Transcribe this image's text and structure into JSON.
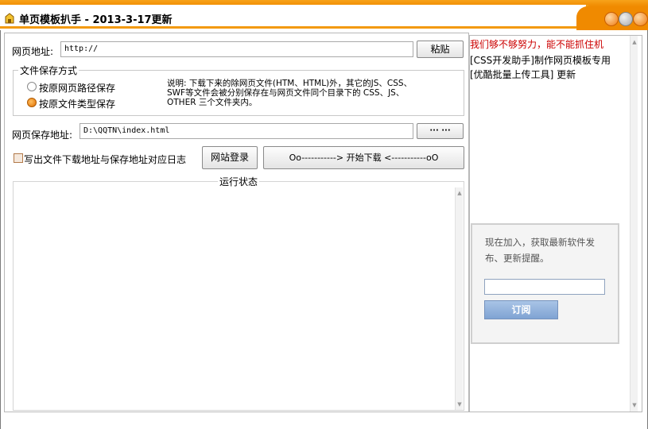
{
  "window": {
    "title": "单页模板扒手 - 2013-3-17更新"
  },
  "url_row": {
    "label": "网页地址:",
    "value": "http://",
    "paste_button": "粘贴"
  },
  "save_mode": {
    "legend": "文件保存方式",
    "options": [
      {
        "label": "按原网页路径保存",
        "checked": false
      },
      {
        "label": "按原文件类型保存",
        "checked": true
      }
    ],
    "note_lines": [
      "说明: 下载下来的除网页文件(HTM、HTML)外，其它的JS、CSS、",
      "SWF等文件会被分别保存在与网页文件同个目录下的 CSS、JS、",
      "OTHER 三个文件夹内。"
    ]
  },
  "save_path": {
    "label": "网页保存地址:",
    "value": "D:\\QQTN\\index.html",
    "browse_button": "··· ···"
  },
  "log_checkbox": {
    "label": "写出文件下载地址与保存地址对应日志",
    "checked": false
  },
  "login_button": "网站登录",
  "download_button": "Oo-----------> 开始下载 <-----------oO",
  "status": {
    "legend": "运行状态"
  },
  "sidebar": {
    "links": [
      {
        "text": "我们够不够努力，能不能抓住机",
        "color": "#cc0000"
      },
      {
        "text": "[CSS开发助手]制作网页模板专用",
        "color": "#000000"
      },
      {
        "text": "[优酷批量上传工具] 更新",
        "color": "#000000"
      }
    ],
    "subscribe": {
      "text": "现在加入，获取最新软件发布、更新提醒。",
      "input_value": "",
      "button": "订阅"
    }
  },
  "colors": {
    "accent_orange": "#f08a00",
    "subscribe_blue": "#7fa3d3",
    "alert_red": "#cc0000"
  }
}
